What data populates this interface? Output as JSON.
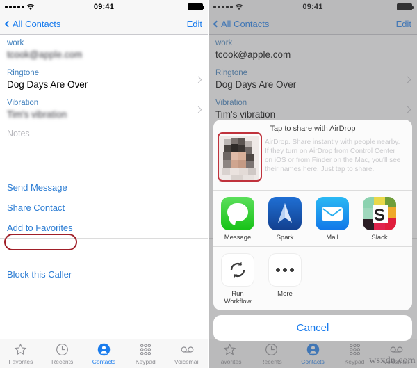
{
  "statusbar": {
    "time": "09:41",
    "signal_dots": 5
  },
  "navbar": {
    "back_label": "All Contacts",
    "edit_label": "Edit"
  },
  "contact": {
    "email_label": "work",
    "email_value": "tcook@apple.com",
    "ringtone_label": "Ringtone",
    "ringtone_value": "Dog Days Are Over",
    "vibration_label": "Vibration",
    "vibration_value": "Tim's vibration",
    "notes_placeholder": "Notes"
  },
  "actions": {
    "send_message": "Send Message",
    "share_contact": "Share Contact",
    "add_to_favorites": "Add to Favorites",
    "block_caller": "Block this Caller"
  },
  "tabbar": {
    "items": [
      {
        "label": "Favorites",
        "icon": "star-icon",
        "active": false
      },
      {
        "label": "Recents",
        "icon": "clock-icon",
        "active": false
      },
      {
        "label": "Contacts",
        "icon": "contact-icon",
        "active": true
      },
      {
        "label": "Keypad",
        "icon": "keypad-icon",
        "active": false
      },
      {
        "label": "Voicemail",
        "icon": "voicemail-icon",
        "active": false
      }
    ]
  },
  "share_sheet": {
    "airdrop_title": "Tap to share with AirDrop",
    "airdrop_description": "AirDrop. Share instantly with people nearby. If they turn on AirDrop from Control Center on iOS or from Finder on the Mac, you'll see their names here. Just tap to share.",
    "apps": [
      {
        "label": "Message",
        "icon": "message-app-icon"
      },
      {
        "label": "Spark",
        "icon": "spark-app-icon"
      },
      {
        "label": "Mail",
        "icon": "mail-app-icon"
      },
      {
        "label": "Slack",
        "icon": "slack-app-icon"
      }
    ],
    "actions": [
      {
        "label": "Run Workflow",
        "icon": "workflow-icon"
      },
      {
        "label": "More",
        "icon": "more-icon"
      }
    ],
    "cancel_label": "Cancel"
  },
  "watermark": {
    "text": "wsxdn.com"
  },
  "annotations": {
    "share_contact_highlight_color": "#a01f28",
    "airdrop_avatar_highlight_color": "#c0323c"
  }
}
